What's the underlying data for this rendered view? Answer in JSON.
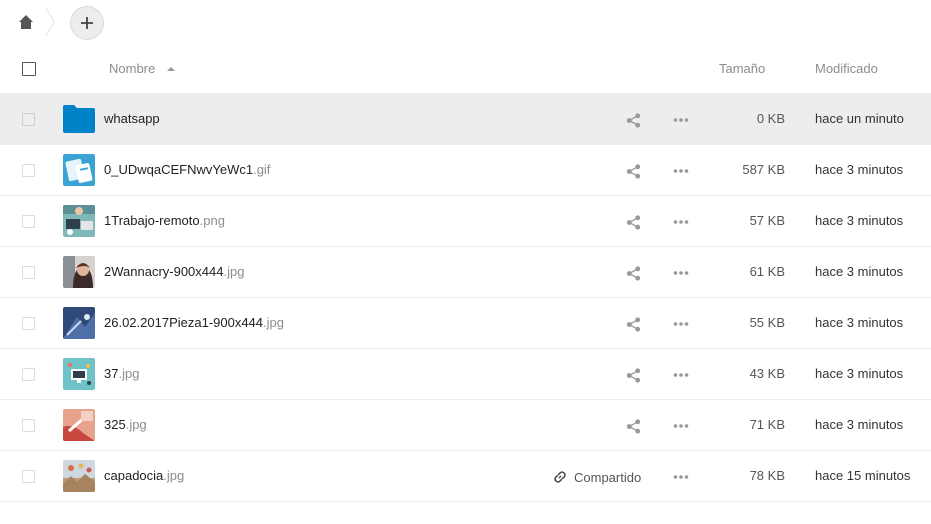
{
  "breadcrumb": {
    "home_icon": "home-icon",
    "add_icon": "plus-icon"
  },
  "header": {
    "name_label": "Nombre",
    "size_label": "Tamaño",
    "modified_label": "Modificado",
    "sort": "ascending"
  },
  "files": [
    {
      "type": "folder",
      "name": "whatsapp",
      "ext": "",
      "size": "0 KB",
      "modified": "hace un minuto",
      "shared": false,
      "highlighted": true
    },
    {
      "type": "image",
      "name": "0_UDwqaCEFNwvYeWc1",
      "ext": ".gif",
      "size": "587 KB",
      "modified": "hace 3 minutos",
      "shared": false,
      "highlighted": false
    },
    {
      "type": "image",
      "name": "1Trabajo-remoto",
      "ext": ".png",
      "size": "57 KB",
      "modified": "hace 3 minutos",
      "shared": false,
      "highlighted": false
    },
    {
      "type": "image",
      "name": "2Wannacry-900x444",
      "ext": ".jpg",
      "size": "61 KB",
      "modified": "hace 3 minutos",
      "shared": false,
      "highlighted": false
    },
    {
      "type": "image",
      "name": "26.02.2017Pieza1-900x444",
      "ext": ".jpg",
      "size": "55 KB",
      "modified": "hace 3 minutos",
      "shared": false,
      "highlighted": false
    },
    {
      "type": "image",
      "name": "37",
      "ext": ".jpg",
      "size": "43 KB",
      "modified": "hace 3 minutos",
      "shared": false,
      "highlighted": false
    },
    {
      "type": "image",
      "name": "325",
      "ext": ".jpg",
      "size": "71 KB",
      "modified": "hace 3 minutos",
      "shared": false,
      "highlighted": false
    },
    {
      "type": "image",
      "name": "capadocia",
      "ext": ".jpg",
      "size": "78 KB",
      "modified": "hace 15 minutos",
      "shared": true,
      "shared_label": "Compartido",
      "highlighted": false
    }
  ],
  "colors": {
    "folder": "#0082c9",
    "highlight_row": "#ededed",
    "muted_text": "#8c8c8c"
  }
}
